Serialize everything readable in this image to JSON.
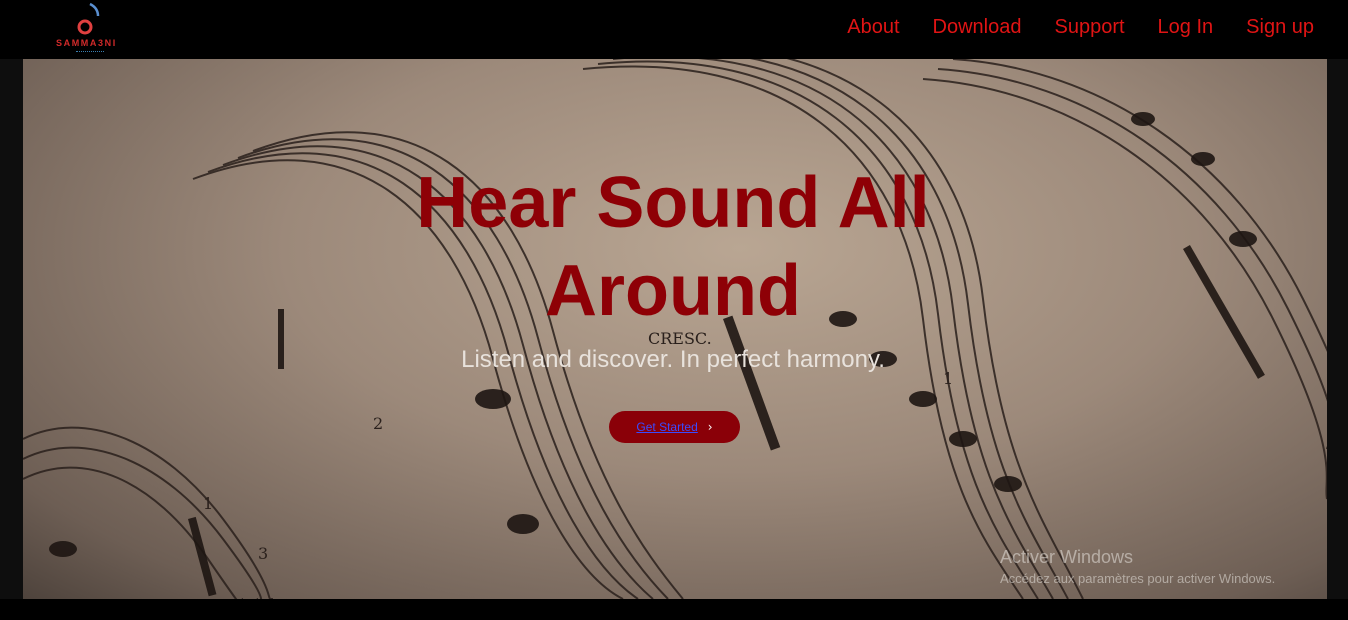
{
  "brand": {
    "name": "SAMMA3NI",
    "logo_icon": "music-note-icon",
    "accent_color": "#e01414"
  },
  "nav": {
    "links": [
      {
        "label": "About"
      },
      {
        "label": "Download"
      },
      {
        "label": "Support"
      },
      {
        "label": "Log In"
      },
      {
        "label": "Sign up"
      }
    ]
  },
  "hero": {
    "title": "Hear Sound All Around",
    "subtitle": "Listen and discover. In perfect harmony.",
    "cta_label": "Get Started",
    "cta_icon": "chevron-right-icon",
    "background": "sheet-music-photo"
  },
  "watermark": {
    "title": "Activer Windows",
    "subtitle": "Accédez aux paramètres pour activer Windows."
  }
}
